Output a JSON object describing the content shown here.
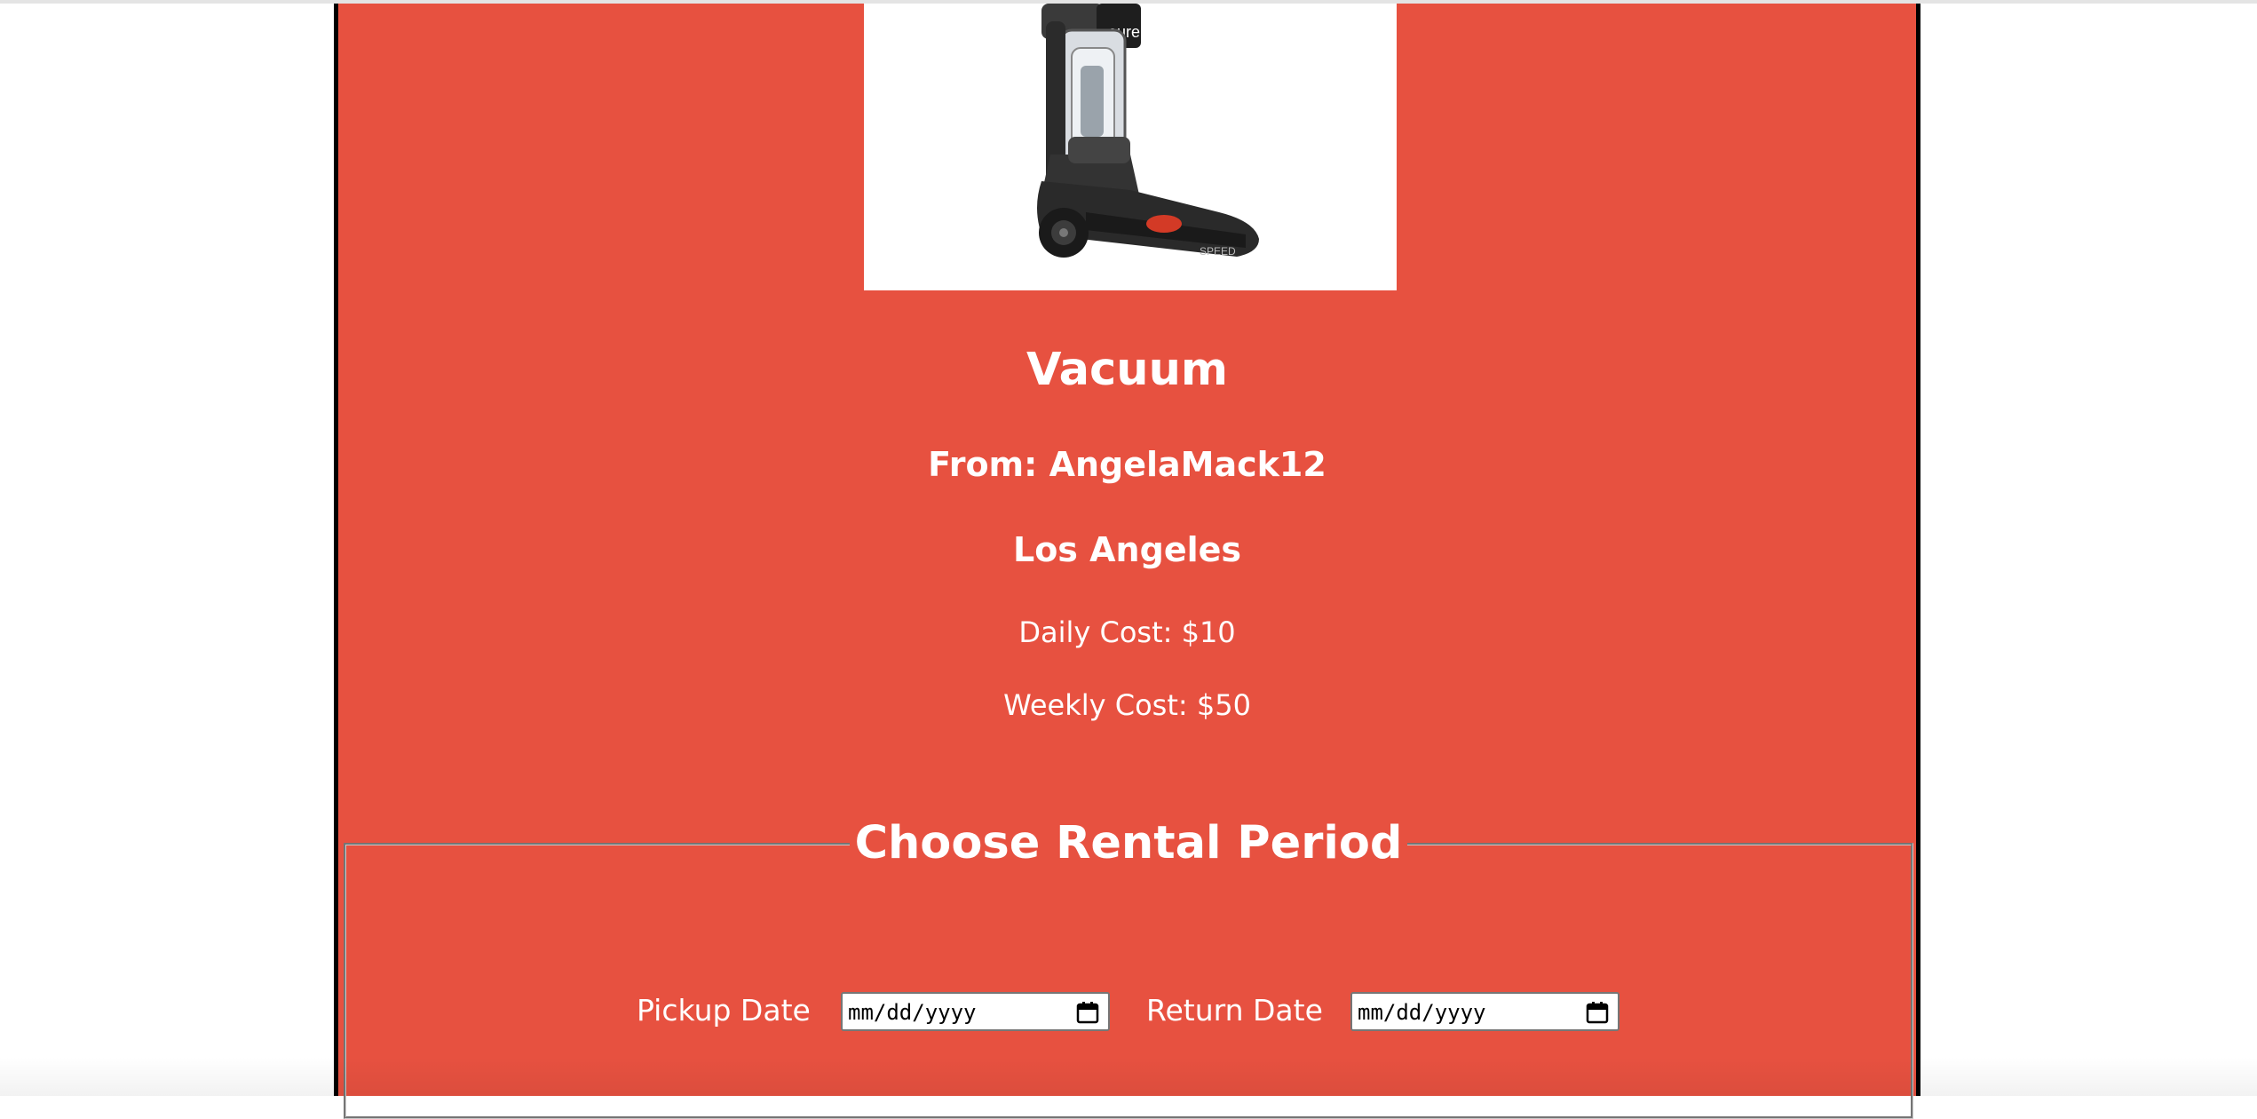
{
  "item": {
    "title": "Vacuum",
    "owner": "From: AngelaMack12",
    "location": "Los Angeles",
    "daily_cost": "Daily Cost: $10",
    "weekly_cost": "Weekly Cost: $50",
    "image_brand_text": "eureka",
    "image_model_text": "SPEED"
  },
  "rental": {
    "legend": "Choose Rental Period",
    "pickup_label": "Pickup Date",
    "pickup_placeholder": "mm/dd/yyyy",
    "return_label": "Return Date",
    "return_placeholder": "mm/dd/yyyy"
  },
  "colors": {
    "card_background": "#e75140",
    "text": "#ffffff",
    "card_border": "#000000"
  }
}
